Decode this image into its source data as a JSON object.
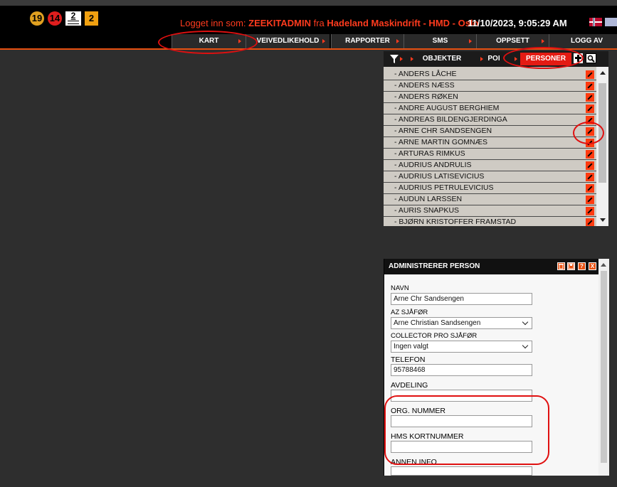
{
  "header": {
    "badges": {
      "red_circle": "14",
      "yellow_circle": "19",
      "white_box": "2",
      "orange_box": "2"
    },
    "login_prefix": "Logget inn som: ",
    "login_user": "ZEEKITADMIN",
    "login_mid": " fra ",
    "login_company": "Hadeland Maskindrift - HMD - Oslo",
    "datetime": "11/10/2023, 9:05:29 AM"
  },
  "menu": [
    "KART",
    "VEIVEDLIKEHOLD",
    "RAPPORTER",
    "SMS",
    "OPPSETT",
    "LOGG AV"
  ],
  "object_panel": {
    "tabs": {
      "objects": "OBJEKTER",
      "poi": "POI",
      "persons": "PERSONER"
    },
    "persons": [
      "- ANDERS LÅCHE",
      "- ANDERS NÆSS",
      "- ANDERS RØKEN",
      "- ANDRE AUGUST BERGHIEM",
      "- ANDREAS BILDENGJERDINGA",
      "- ARNE CHR SANDSENGEN",
      "- ARNE MARTIN GOMNÆS",
      "- ARTURAS RIMKUS",
      "- AUDRIUS ANDRULIS",
      "- AUDRIUS LATISEVICIUS",
      "- AUDRIUS PETRULEVICIUS",
      "- AUDUN LARSSEN",
      "- AURIS SNAPKUS",
      "- BJØRN KRISTOFFER FRAMSTAD"
    ]
  },
  "admin_panel": {
    "title": "ADMINISTRERER PERSON",
    "buttons": {
      "help": "?",
      "close": "X"
    },
    "fields": {
      "name_label": "NAVN",
      "name_value": "Arne Chr Sandsengen",
      "az_label": "AZ SJÅFØR",
      "az_value": "Arne Christian Sandsengen",
      "collector_label": "COLLECTOR PRO SJÅFØR",
      "collector_value": "Ingen valgt",
      "phone_label": "TELEFON",
      "phone_value": "95788468",
      "department_label": "AVDELING",
      "org_label": "ORG. NUMMER",
      "hms_label": "HMS KORTNUMMER",
      "other_label": "ANNEN INFO"
    }
  },
  "colors": {
    "accent": "#e41b13",
    "annotation": "#e01010"
  }
}
